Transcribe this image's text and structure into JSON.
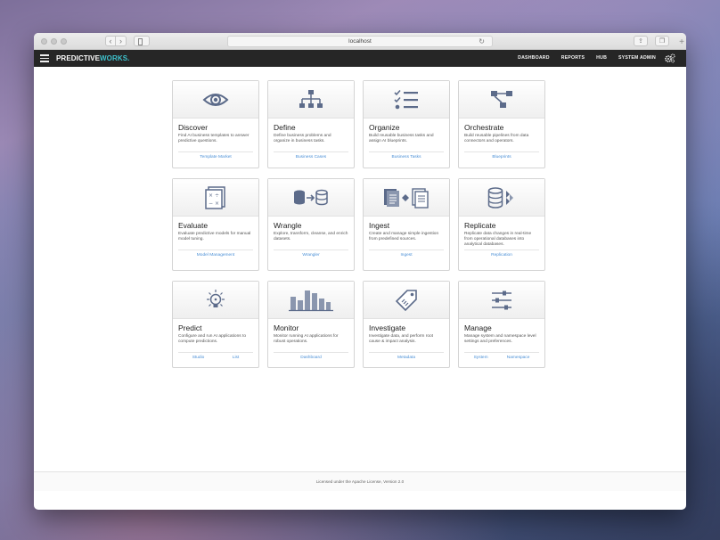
{
  "browser": {
    "url": "localhost"
  },
  "app": {
    "brand_primary": "PREDICTIVE",
    "brand_accent": "WORKS.",
    "accent_color": "#3ec1cc",
    "nav": [
      {
        "label": "DASHBOARD"
      },
      {
        "label": "REPORTS"
      },
      {
        "label": "HUB"
      },
      {
        "label": "SYSTEM ADMIN"
      }
    ]
  },
  "cards": [
    {
      "title": "Discover",
      "icon": "eye-icon",
      "desc": "Find AI business templates to answer predictive questions.",
      "links": [
        "Template Market"
      ]
    },
    {
      "title": "Define",
      "icon": "hierarchy-icon",
      "desc": "Define business problems and organize in business tasks.",
      "links": [
        "Business Cases"
      ]
    },
    {
      "title": "Organize",
      "icon": "checklist-icon",
      "desc": "Build reusable business tasks and assign AI blueprints.",
      "links": [
        "Business Tasks"
      ]
    },
    {
      "title": "Orchestrate",
      "icon": "pipeline-icon",
      "desc": "Build reusable pipelines from data connectors and operators.",
      "links": [
        "Blueprints"
      ]
    },
    {
      "title": "Evaluate",
      "icon": "calculator-icon",
      "desc": "Evaluate predictive models for manual model tuning.",
      "links": [
        "Model Management"
      ]
    },
    {
      "title": "Wrangle",
      "icon": "database-transform-icon",
      "desc": "Explore, transform, cleanse, and enrich datasets.",
      "links": [
        "Wrangler"
      ]
    },
    {
      "title": "Ingest",
      "icon": "documents-exchange-icon",
      "desc": "Create and manage simple ingestion from predefined sources.",
      "links": [
        "Ingest"
      ]
    },
    {
      "title": "Replicate",
      "icon": "database-replicate-icon",
      "desc": "Replicate data changes in real-time from operational databases into analytical databases.",
      "links": [
        "Replication"
      ]
    },
    {
      "title": "Predict",
      "icon": "lightbulb-icon",
      "desc": "Configure and run AI applications to compute predictions.",
      "links": [
        "Studio",
        "List"
      ]
    },
    {
      "title": "Monitor",
      "icon": "bar-chart-icon",
      "desc": "Monitor running AI applications for robust operations.",
      "links": [
        "Dashboard"
      ]
    },
    {
      "title": "Investigate",
      "icon": "tag-icon",
      "desc": "Investigate data, and perform root cause & impact analysis.",
      "links": [
        "Metadata"
      ]
    },
    {
      "title": "Manage",
      "icon": "sliders-icon",
      "desc": "Manage system and namespace level settings and preferences.",
      "links": [
        "System",
        "Namespace"
      ]
    }
  ],
  "footer": {
    "text": "Licensed under the Apache License, Version 2.0"
  },
  "colors": {
    "icon": "#5c6b8a",
    "link": "#4a8fd6",
    "navbar": "#262626"
  }
}
